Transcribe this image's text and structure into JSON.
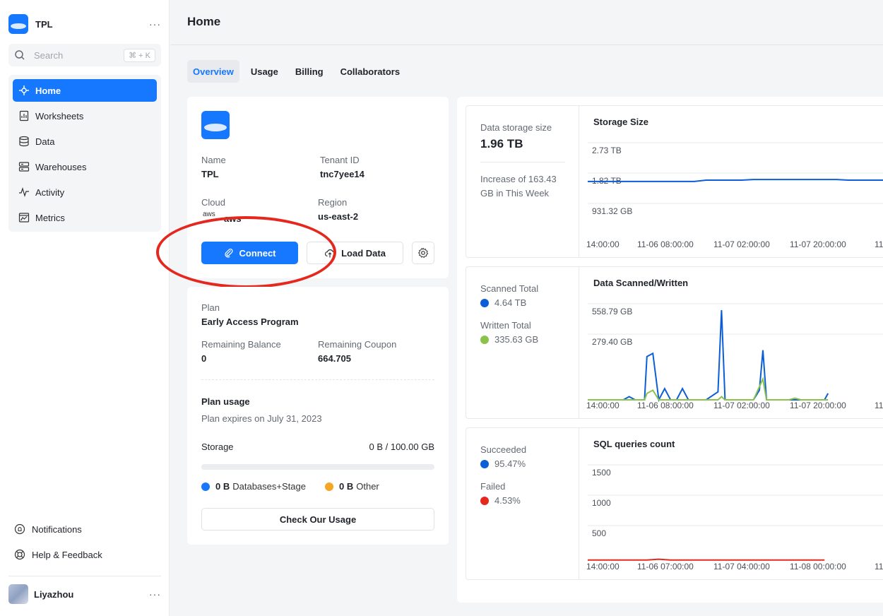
{
  "workspace": {
    "name": "TPL",
    "more": "···"
  },
  "search": {
    "placeholder": "Search",
    "shortcut": "⌘ + K"
  },
  "sidebar": {
    "items": [
      {
        "label": "Home",
        "icon": "home-icon",
        "active": true
      },
      {
        "label": "Worksheets",
        "icon": "worksheet-icon"
      },
      {
        "label": "Data",
        "icon": "database-icon"
      },
      {
        "label": "Warehouses",
        "icon": "warehouse-icon"
      },
      {
        "label": "Activity",
        "icon": "activity-icon"
      },
      {
        "label": "Metrics",
        "icon": "metrics-icon"
      }
    ],
    "bottom": [
      {
        "label": "Notifications",
        "icon": "bell-icon"
      },
      {
        "label": "Help & Feedback",
        "icon": "help-icon"
      }
    ],
    "user": {
      "name": "Liyazhou",
      "more": "···"
    }
  },
  "page": {
    "title": "Home"
  },
  "tabs": [
    {
      "label": "Overview",
      "active": true
    },
    {
      "label": "Usage"
    },
    {
      "label": "Billing"
    },
    {
      "label": "Collaborators"
    }
  ],
  "tenant": {
    "name_label": "Name",
    "name": "TPL",
    "tenant_id_label": "Tenant ID",
    "tenant_id": "tnc7yee14",
    "cloud_label": "Cloud",
    "cloud_logo": "aws",
    "cloud": "aws",
    "region_label": "Region",
    "region": "us-east-2",
    "connect_label": "Connect",
    "load_data_label": "Load Data"
  },
  "plan": {
    "plan_label": "Plan",
    "plan": "Early Access Program",
    "balance_label": "Remaining Balance",
    "balance": "0",
    "coupon_label": "Remaining Coupon",
    "coupon": "664.705",
    "usage_title": "Plan usage",
    "expires": "Plan expires on July 31, 2023",
    "storage_label": "Storage",
    "storage_value": "0 B / 100.00 GB",
    "storage_used_fraction": 0,
    "legend": [
      {
        "value": "0 B",
        "label": "Databases+Stage",
        "color": "#1677ff"
      },
      {
        "value": "0 B",
        "label": "Other",
        "color": "#f5a623"
      }
    ],
    "check_usage_label": "Check Our Usage"
  },
  "metrics": {
    "storage": {
      "label": "Data storage size",
      "value": "1.96 TB",
      "increase": "Increase of 163.43 GB in This Week"
    },
    "scanned": {
      "scanned_label": "Scanned Total",
      "scanned_value": "4.64 TB",
      "scanned_color": "#0b5ed7",
      "written_label": "Written Total",
      "written_value": "335.63 GB",
      "written_color": "#8bc34a"
    },
    "sql": {
      "succeeded_label": "Succeeded",
      "succeeded_value": "95.47%",
      "succeeded_color": "#0b5ed7",
      "failed_label": "Failed",
      "failed_value": "4.53%",
      "failed_color": "#e5281e"
    }
  },
  "chart_data": [
    {
      "type": "line",
      "title": "Storage Size",
      "y_ticks": [
        "2.73 TB",
        "1.82 TB",
        "931.32 GB"
      ],
      "x_ticks": [
        "14:00:00",
        "11-06 08:00:00",
        "11-07 02:00:00",
        "11-07 20:00:00",
        "11-"
      ],
      "ylim": [
        0,
        3000
      ],
      "series": [
        {
          "color": "#0b5ed7",
          "x": [
            0,
            9,
            10,
            13,
            14,
            21,
            22,
            25
          ],
          "values": [
            1790,
            1790,
            1830,
            1830,
            1850,
            1850,
            1830,
            1830
          ]
        }
      ]
    },
    {
      "type": "line",
      "title": "Data Scanned/Written",
      "y_ticks": [
        "558.79 GB",
        "279.40 GB"
      ],
      "x_ticks": [
        "14:00:00",
        "11-06 08:00:00",
        "11-07 02:00:00",
        "11-07 20:00:00",
        "11-"
      ],
      "ylim": [
        0,
        600
      ],
      "series": [
        {
          "color": "#0b5ed7",
          "x": [
            0,
            3,
            3.5,
            4,
            4.8,
            5,
            5.5,
            6,
            6.5,
            7,
            7.5,
            8,
            8.5,
            10,
            11,
            11.3,
            11.6,
            12,
            14,
            14.5,
            14.8,
            15.1,
            15.5,
            17,
            20,
            20.3
          ],
          "values": [
            0,
            0,
            20,
            0,
            0,
            270,
            290,
            0,
            70,
            0,
            0,
            70,
            0,
            0,
            50,
            560,
            0,
            0,
            0,
            60,
            310,
            0,
            0,
            0,
            0,
            40
          ]
        },
        {
          "color": "#8bc34a",
          "x": [
            0,
            3,
            3.5,
            4,
            4.8,
            5,
            5.5,
            6,
            10,
            11,
            11.3,
            11.6,
            14,
            14.8,
            15.1,
            17,
            17.5,
            18,
            20.3
          ],
          "values": [
            0,
            0,
            0,
            0,
            0,
            40,
            60,
            0,
            0,
            0,
            20,
            0,
            0,
            130,
            0,
            0,
            10,
            0,
            0
          ]
        }
      ]
    },
    {
      "type": "line",
      "title": "SQL queries count",
      "y_ticks": [
        "1500",
        "1000",
        "500"
      ],
      "x_ticks": [
        "14:00:00",
        "11-06 07:00:00",
        "11-07 04:00:00",
        "11-08 00:00:00",
        "11-"
      ],
      "ylim": [
        0,
        1700
      ],
      "series": [
        {
          "color": "#e5281e",
          "x": [
            0,
            5,
            6,
            7,
            20
          ],
          "values": [
            15,
            15,
            30,
            15,
            15
          ]
        }
      ]
    }
  ]
}
